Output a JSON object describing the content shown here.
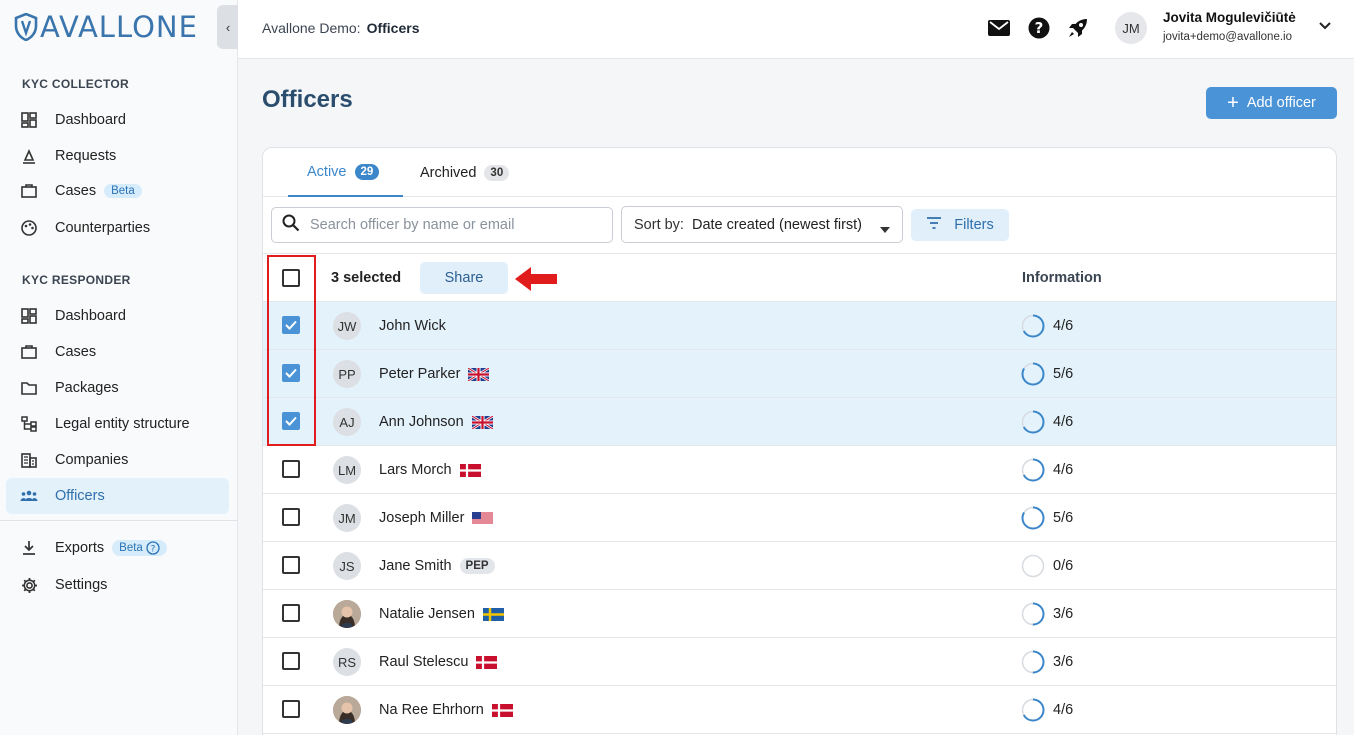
{
  "brand": {
    "logo_text": "AVALLONE"
  },
  "sidebar": {
    "sections": [
      {
        "title": "KYC COLLECTOR"
      },
      {
        "title": "KYC RESPONDER"
      }
    ],
    "collector_items": [
      {
        "label": "Dashboard",
        "icon": "dashboard-icon"
      },
      {
        "label": "Requests",
        "icon": "requests-icon"
      },
      {
        "label": "Cases",
        "icon": "briefcase-icon",
        "badge": "Beta"
      },
      {
        "label": "Counterparties",
        "icon": "palette-icon"
      }
    ],
    "responder_items": [
      {
        "label": "Dashboard",
        "icon": "dashboard-icon"
      },
      {
        "label": "Cases",
        "icon": "briefcase-icon"
      },
      {
        "label": "Packages",
        "icon": "folder-icon"
      },
      {
        "label": "Legal entity structure",
        "icon": "hierarchy-icon"
      },
      {
        "label": "Companies",
        "icon": "building-icon"
      },
      {
        "label": "Officers",
        "icon": "people-icon",
        "active": true
      }
    ],
    "bottom_items": [
      {
        "label": "Exports",
        "icon": "download-icon",
        "badge": "Beta"
      },
      {
        "label": "Settings",
        "icon": "gear-icon"
      }
    ]
  },
  "header": {
    "org": "Avallone Demo:",
    "page": "Officers",
    "user": {
      "initials": "JM",
      "name": "Jovita Mogulevičiūtė",
      "email": "jovita+demo@avallone.io"
    }
  },
  "main": {
    "title": "Officers",
    "add_label": "Add officer",
    "tabs": [
      {
        "label": "Active",
        "count": "29",
        "active": true
      },
      {
        "label": "Archived",
        "count": "30",
        "active": false
      }
    ],
    "search_placeholder": "Search officer by name or email",
    "sort_label": "Sort by:",
    "sort_value": "Date created (newest first)",
    "filters_label": "Filters",
    "selected_label": "3 selected",
    "share_label": "Share",
    "info_header": "Information",
    "rows": [
      {
        "initials": "JW",
        "name": "John Wick",
        "flag": "",
        "pep": "",
        "progress": "4/6",
        "fraction": 0.667,
        "checked": true
      },
      {
        "initials": "PP",
        "name": "Peter Parker",
        "flag": "uk",
        "pep": "",
        "progress": "5/6",
        "fraction": 0.833,
        "checked": true
      },
      {
        "initials": "AJ",
        "name": "Ann Johnson",
        "flag": "uk",
        "pep": "",
        "progress": "4/6",
        "fraction": 0.667,
        "checked": true
      },
      {
        "initials": "LM",
        "name": "Lars Morch",
        "flag": "dk",
        "pep": "",
        "progress": "4/6",
        "fraction": 0.667,
        "checked": false
      },
      {
        "initials": "JM",
        "name": "Joseph Miller",
        "flag": "us",
        "pep": "",
        "progress": "5/6",
        "fraction": 0.833,
        "checked": false
      },
      {
        "initials": "JS",
        "name": "Jane Smith",
        "flag": "",
        "pep": "PEP",
        "progress": "0/6",
        "fraction": 0,
        "checked": false
      },
      {
        "initials": "",
        "photo": true,
        "name": "Natalie Jensen",
        "flag": "se",
        "pep": "",
        "progress": "3/6",
        "fraction": 0.5,
        "checked": false
      },
      {
        "initials": "RS",
        "name": "Raul Stelescu",
        "flag": "dk",
        "pep": "",
        "progress": "3/6",
        "fraction": 0.5,
        "checked": false
      },
      {
        "initials": "",
        "photo": true,
        "name": "Na Ree Ehrhorn",
        "flag": "dk",
        "pep": "",
        "progress": "4/6",
        "fraction": 0.667,
        "checked": false
      }
    ]
  },
  "colors": {
    "accent": "#4a93d6",
    "annotation": "#e01c1c",
    "selected_row": "#e4f2fc"
  }
}
